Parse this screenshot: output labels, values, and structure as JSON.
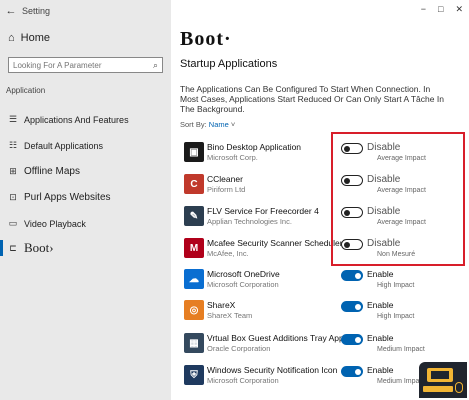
{
  "window": {
    "title": "Setting",
    "back_icon": "back-arrow-icon",
    "controls": [
      "−",
      "□",
      "✕"
    ]
  },
  "sidebar": {
    "home_label": "Home",
    "search_placeholder": "Looking For A Parameter",
    "section_label": "Application",
    "items": [
      {
        "label": "Applications And Features",
        "icon": "list-icon"
      },
      {
        "label": "Default Applications",
        "icon": "default-apps-icon"
      },
      {
        "label": "Offline Maps",
        "icon": "map-icon"
      },
      {
        "label": "Purl Apps Websites",
        "icon": "web-icon"
      },
      {
        "label": "Video Playback",
        "icon": "video-icon"
      },
      {
        "label": "Boot›",
        "icon": "startup-icon"
      }
    ]
  },
  "main": {
    "title": "Boot·",
    "subtitle": "Startup Applications",
    "description": "The Applications Can Be Configured To Start When Connection. In Most Cases, Applications Start Reduced Or Can Only Start A Tâche In The Background.",
    "sort_label": "Sort By:",
    "sort_value": "Name",
    "apps": [
      {
        "name": "Bino Desktop Application",
        "publisher": "Microsoft Corp.",
        "state": "Disable",
        "impact": "Average Impact",
        "enabled": false,
        "icon_color": "#1a1a1a",
        "icon_text": "▣"
      },
      {
        "name": "CCleaner",
        "publisher": "Piriform Ltd",
        "state": "Disable",
        "impact": "Average Impact",
        "enabled": false,
        "icon_color": "#c0392b",
        "icon_text": "C"
      },
      {
        "name": "FLV Service For Freecorder 4",
        "publisher": "Applian Technologies Inc.",
        "state": "Disable",
        "impact": "Average Impact",
        "enabled": false,
        "icon_color": "#2c3e50",
        "icon_text": "✎"
      },
      {
        "name": "Mcafee Security Scanner Scheduler",
        "publisher": "McAfee, Inc.",
        "state": "Disable",
        "impact": "Non Mesuré",
        "enabled": false,
        "icon_color": "#b0001a",
        "icon_text": "M"
      },
      {
        "name": "Microsoft OneDrive",
        "publisher": "Microsoft Corporation",
        "state": "Enable",
        "impact": "High Impact",
        "enabled": true,
        "icon_color": "#0a6ed1",
        "icon_text": "☁"
      },
      {
        "name": "ShareX",
        "publisher": "ShareX Team",
        "state": "Enable",
        "impact": "High Impact",
        "enabled": true,
        "icon_color": "#e67e22",
        "icon_text": "◎"
      },
      {
        "name": "Vrtual Box Guest Additions Tray App...",
        "publisher": "Oracle Corporation",
        "state": "Enable",
        "impact": "Medium Impact",
        "enabled": true,
        "icon_color": "#34495e",
        "icon_text": "▦"
      },
      {
        "name": "Windows Security Notification Icon",
        "publisher": "Microsoft Corporation",
        "state": "Enable",
        "impact": "Medium Impact",
        "enabled": true,
        "icon_color": "#1f3a5f",
        "icon_text": "⛨"
      }
    ]
  },
  "colors": {
    "accent": "#0063b1",
    "highlight": "#d81e2a",
    "sidebar_bg": "#e9e9e9"
  }
}
